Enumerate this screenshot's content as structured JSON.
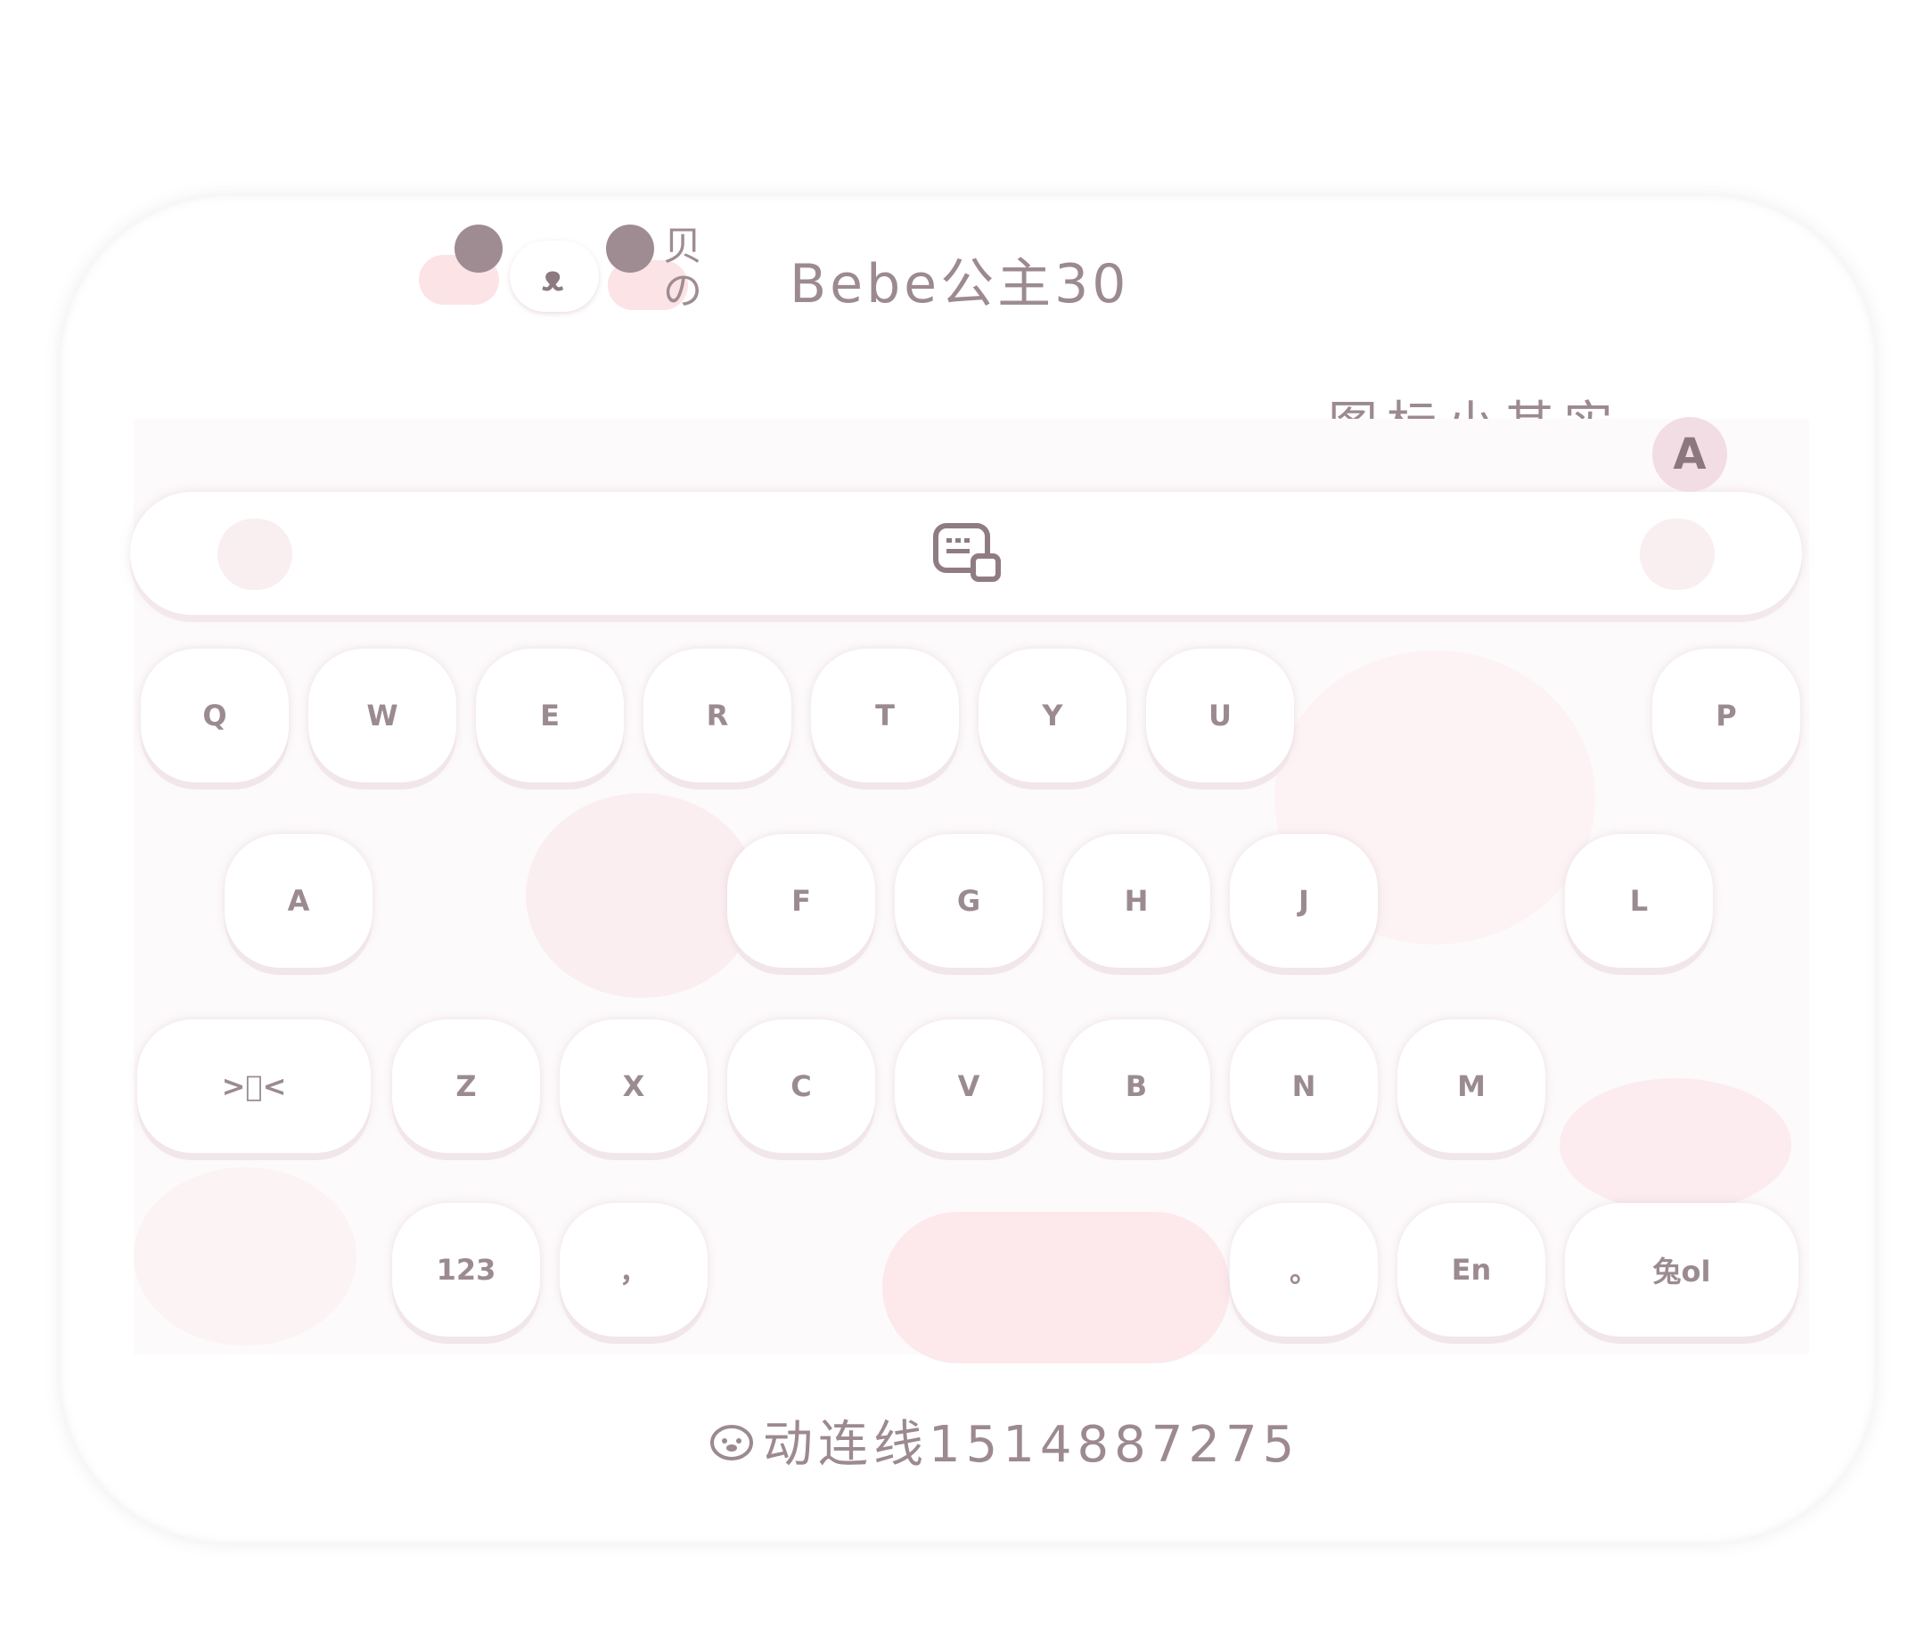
{
  "header": {
    "logo_text": "贝の",
    "username": "Bebe公主30",
    "tagline": "图标小其实",
    "a_button_label": "A"
  },
  "toolbar": {
    "center_icon": "keyboard-switch-icon",
    "left_icon": "bunny-icon",
    "right_icon": "bunny-icon"
  },
  "keyboard": {
    "row1": [
      "Q",
      "W",
      "E",
      "R",
      "T",
      "Y",
      "U",
      "P"
    ],
    "row2": [
      "A",
      "F",
      "G",
      "H",
      "J",
      "L"
    ],
    "row3": [
      "Z",
      "X",
      "C",
      "V",
      "B",
      "N",
      "M"
    ],
    "row3_shift_label": ">᪲<",
    "row4": {
      "num_label": "123",
      "comma_label": "，",
      "period_label": "。",
      "lang_label": "En",
      "enter_label": "兔ol"
    }
  },
  "footer": {
    "watermark": "动连线1514887275"
  },
  "colors": {
    "text": "#9c8a90",
    "pink": "#fbe3e6",
    "key_bg": "#ffffff"
  }
}
